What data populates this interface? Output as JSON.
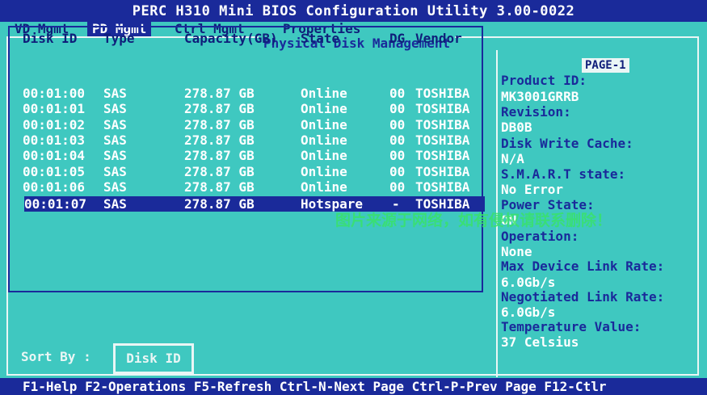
{
  "title": "PERC H310 Mini BIOS Configuration Utility 3.00-0022",
  "menu": [
    {
      "label": "VD Mgmt",
      "active": false
    },
    {
      "label": "PD Mgmt",
      "active": true
    },
    {
      "label": "Ctrl Mgmt",
      "active": false
    },
    {
      "label": "Properties",
      "active": false
    }
  ],
  "panel_title": "Physical Disk Management",
  "table": {
    "headers": [
      "Disk ID",
      "Type",
      "Capacity(GB)",
      "State",
      "DG",
      "Vendor"
    ],
    "rows": [
      {
        "disk_id": "00:01:00",
        "type": "SAS",
        "capacity": "278.87 GB",
        "state": "Online",
        "dg": "00",
        "vendor": "TOSHIBA"
      },
      {
        "disk_id": "00:01:01",
        "type": "SAS",
        "capacity": "278.87 GB",
        "state": "Online",
        "dg": "00",
        "vendor": "TOSHIBA"
      },
      {
        "disk_id": "00:01:02",
        "type": "SAS",
        "capacity": "278.87 GB",
        "state": "Online",
        "dg": "00",
        "vendor": "TOSHIBA"
      },
      {
        "disk_id": "00:01:03",
        "type": "SAS",
        "capacity": "278.87 GB",
        "state": "Online",
        "dg": "00",
        "vendor": "TOSHIBA"
      },
      {
        "disk_id": "00:01:04",
        "type": "SAS",
        "capacity": "278.87 GB",
        "state": "Online",
        "dg": "00",
        "vendor": "TOSHIBA"
      },
      {
        "disk_id": "00:01:05",
        "type": "SAS",
        "capacity": "278.87 GB",
        "state": "Online",
        "dg": "00",
        "vendor": "TOSHIBA"
      },
      {
        "disk_id": "00:01:06",
        "type": "SAS",
        "capacity": "278.87 GB",
        "state": "Online",
        "dg": "00",
        "vendor": "TOSHIBA"
      },
      {
        "disk_id": "00:01:07",
        "type": "SAS",
        "capacity": "278.87 GB",
        "state": "Hotspare",
        "dg": "-",
        "vendor": "TOSHIBA",
        "selected": true
      }
    ]
  },
  "sort": {
    "label": "Sort By :",
    "value": "Disk ID"
  },
  "details": {
    "page": "PAGE-1",
    "product_id_label": "Product ID:",
    "product_id": "MK3001GRRB",
    "revision_label": "Revision:",
    "revision": "DB0B",
    "write_cache_label": "Disk Write Cache:",
    "write_cache": "N/A",
    "smart_label": "S.M.A.R.T state:",
    "smart": "No Error",
    "power_label": "Power State:",
    "power": "ON",
    "operation_label": "Operation:",
    "operation": "None",
    "max_link_label": "Max Device Link Rate:",
    "max_link": "6.0Gb/s",
    "neg_link_label": "Negotiated Link Rate:",
    "neg_link": "6.0Gb/s",
    "temp_label": "Temperature Value:",
    "temp": "37 Celsius"
  },
  "watermark": "图片来源于网络，如有侵权请联系删除！",
  "status_bar": "F1-Help F2-Operations F5-Refresh Ctrl-N-Next Page Ctrl-P-Prev Page F12-Ctlr",
  "colors": {
    "background": "#3fc8c0",
    "bar": "#1a2a9a",
    "highlight_text": "#ffffff",
    "label_text": "#1a2a9a"
  }
}
